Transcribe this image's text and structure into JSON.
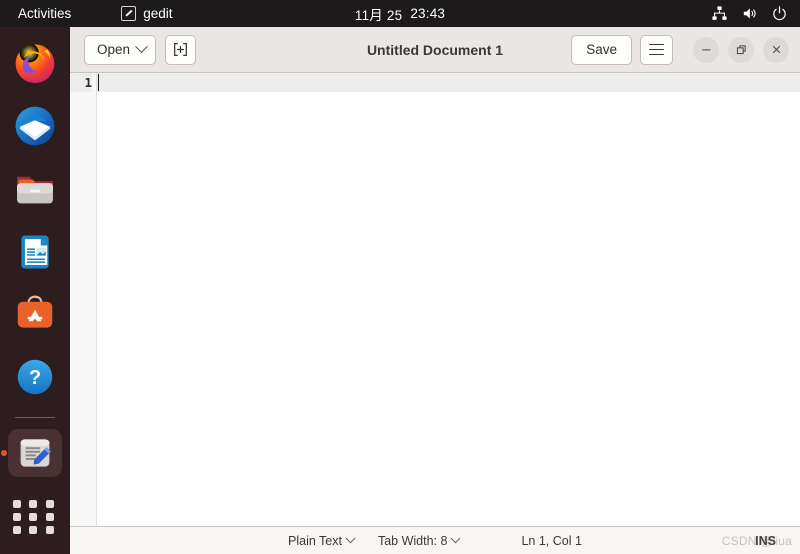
{
  "topbar": {
    "activities": "Activities",
    "app_name": "gedit",
    "app_icon": "gedit-pencil-icon",
    "clock_date": "11月 25",
    "clock_time": "23:43",
    "tray": [
      {
        "name": "network-wired-icon"
      },
      {
        "name": "volume-icon"
      },
      {
        "name": "power-icon"
      }
    ]
  },
  "dock": {
    "items": [
      {
        "name": "firefox",
        "label": "Firefox",
        "active": false
      },
      {
        "name": "thunderbird",
        "label": "Thunderbird Mail",
        "active": false
      },
      {
        "name": "files",
        "label": "Files",
        "active": false
      },
      {
        "name": "libreoffice-writer",
        "label": "LibreOffice Writer",
        "active": false
      },
      {
        "name": "ubuntu-software",
        "label": "Ubuntu Software",
        "active": false
      },
      {
        "name": "help",
        "label": "Help",
        "active": false
      },
      {
        "name": "gedit",
        "label": "gedit",
        "active": true
      }
    ],
    "show_apps_label": "Show Applications"
  },
  "window": {
    "title": "Untitled Document 1",
    "open_label": "Open",
    "new_document_label": "Create a new document",
    "save_label": "Save",
    "menu_label": "Main Menu",
    "controls": {
      "minimize": "Minimize",
      "maximize": "Restore",
      "close": "Close"
    }
  },
  "editor": {
    "line_number": "1",
    "content": ""
  },
  "statusbar": {
    "language": "Plain Text",
    "tab_width": "Tab Width: 8",
    "position": "Ln 1, Col 1",
    "insert_mode": "INS",
    "watermark": "CSDN @liua"
  },
  "colors": {
    "topbar_bg": "#1c1a1a",
    "dock_bg": "#2d1d1f",
    "headerbar_bg": "#e9e6e4",
    "editor_bg": "#ffffff",
    "statusbar_bg": "#f7f6f5",
    "accent": "#e05a20"
  }
}
